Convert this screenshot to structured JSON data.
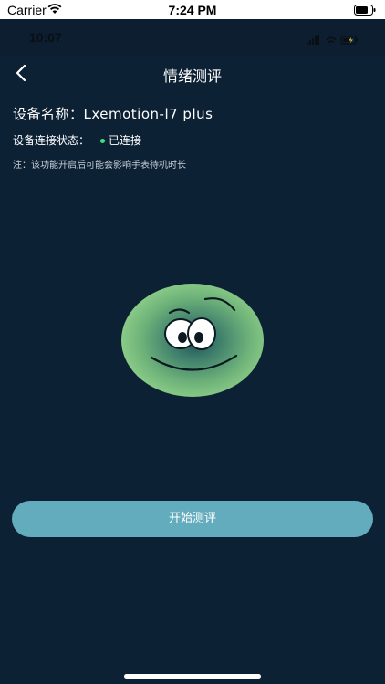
{
  "status_bar": {
    "carrier": "Carrier",
    "time": "7:24 PM"
  },
  "inner_status_bar": {
    "time": "10:07"
  },
  "navbar": {
    "title": "情绪测评",
    "back_icon": "chevron-left-icon"
  },
  "device": {
    "name_label": "设备名称：",
    "name_value": "Lxemotion-l7 plus",
    "connection_label": "设备连接状态：",
    "connection_status": "已连接",
    "connection_color": "#3ee07a"
  },
  "note": "注：该功能开启后可能会影响手表待机时长",
  "face_icon": "smiley-face-icon",
  "action": {
    "start_label": "开始测评",
    "button_color": "#63acbd"
  },
  "colors": {
    "background": "#0d2135"
  }
}
